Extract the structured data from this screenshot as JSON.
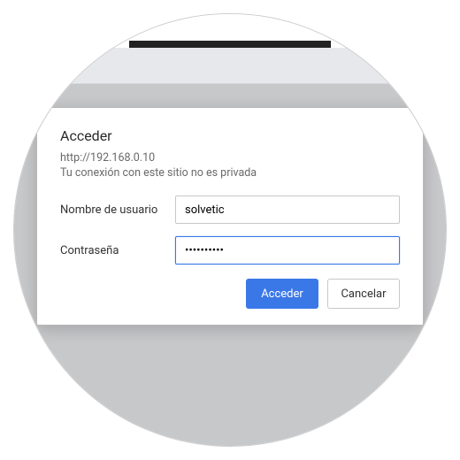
{
  "dialog": {
    "title": "Acceder",
    "url": "http://192.168.0.10",
    "message": "Tu conexión con este sitio no es privada",
    "username_label": "Nombre de usuario",
    "username_value": "solvetic",
    "password_label": "Contraseña",
    "password_value": "••••••••••",
    "submit_label": "Acceder",
    "cancel_label": "Cancelar"
  }
}
